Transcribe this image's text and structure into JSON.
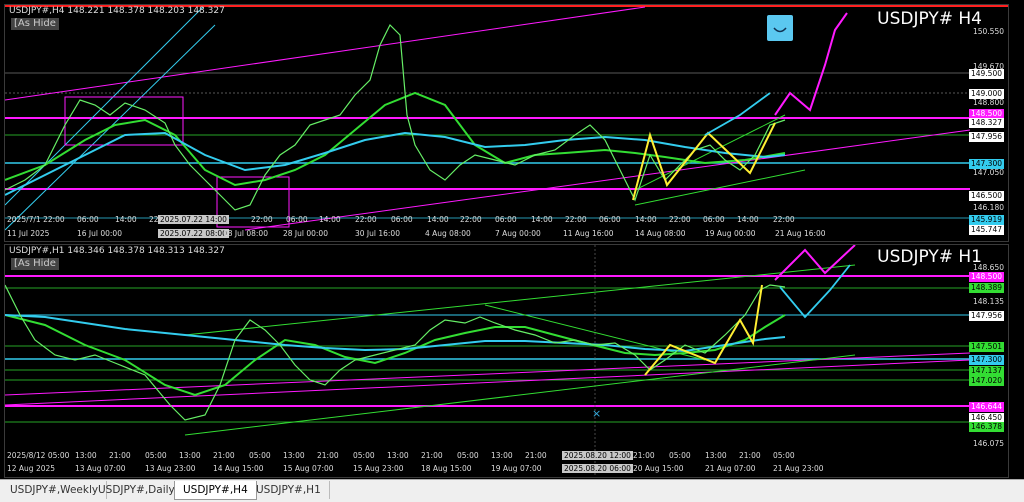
{
  "h4": {
    "header": "USDJPY#,H4  148.221 148.378 148.203 148.327",
    "hide_label": "[As Hide",
    "big_title": "USDJPY# H4",
    "price_boxes": [
      {
        "text": "149.500"
      },
      {
        "text": "149.000"
      },
      {
        "text": "148.500"
      },
      {
        "text": "148.327"
      },
      {
        "text": "147.956"
      },
      {
        "text": "147.300"
      },
      {
        "text": "146.500"
      },
      {
        "text": "145.919"
      },
      {
        "text": "145.747"
      }
    ],
    "price_texts": [
      "150.550",
      "149.670",
      "148.800",
      "147.050",
      "146.180"
    ],
    "time_labels": [
      "11 Jul 2025",
      "16 Jul 00:00",
      "18 Jul 08:00",
      "28 Jul 00:00",
      "30 Jul 16:00",
      "4 Aug 08:00",
      "7 Aug 00:00",
      "11 Aug 16:00",
      "14 Aug 08:00",
      "19 Aug 00:00",
      "21 Aug 16:00"
    ],
    "time_box": "2025.07.22 08:00",
    "inner_times": [
      "2025/7/1 22:00",
      "06:00",
      "14:00",
      "22",
      "2025.07.22 14:00",
      "14:00",
      "22:00",
      "06:00",
      "14:00",
      "22:00",
      "06:00",
      "14:00",
      "22:00",
      "06:00",
      "14:00",
      "22:00",
      "06:00",
      "14:00",
      "22:00",
      "06:00",
      "14:00",
      "22:00"
    ]
  },
  "h1": {
    "header": "USDJPY#,H1  148.346 148.378 148.313 148.327",
    "hide_label": "[As Hide",
    "big_title": "USDJPY# H1",
    "price_boxes": [
      {
        "text": "148.500"
      },
      {
        "text": "148.389"
      },
      {
        "text": "147.956"
      },
      {
        "text": "147.501"
      },
      {
        "text": "147.300"
      },
      {
        "text": "147.137"
      },
      {
        "text": "147.020"
      },
      {
        "text": "146.644"
      },
      {
        "text": "146.450"
      },
      {
        "text": "146.378"
      }
    ],
    "price_texts": [
      "148.650",
      "148.135",
      "146.075"
    ],
    "time_labels": [
      "12 Aug 2025",
      "13 Aug 07:00",
      "13 Aug 23:00",
      "14 Aug 15:00",
      "15 Aug 07:00",
      "15 Aug 23:00",
      "18 Aug 15:00",
      "19 Aug 07:00",
      "20 Aug 15:00",
      "21 Aug 07:00",
      "21 Aug 23:00"
    ],
    "time_box": "2025.08.20 06:00",
    "inner_times": [
      "2025/8/12 05:00",
      "13:00",
      "21:00",
      "05:00",
      "13:00",
      "21:00",
      "05:00",
      "13:00",
      "21:00",
      "05:00",
      "13:00",
      "21:00",
      "05:00",
      "13:00",
      "21:00",
      "2025.08.20 12:00",
      "21:00",
      "05:00",
      "13:00",
      "21:00",
      "05:00"
    ]
  },
  "tabs": [
    {
      "label": "USDJPY#,Weekly",
      "active": false
    },
    {
      "label": "USDJPY#,Daily",
      "active": false
    },
    {
      "label": "USDJPY#,H4",
      "active": true
    },
    {
      "label": "USDJPY#,H1",
      "active": false
    }
  ],
  "colors": {
    "background": "#000000",
    "magenta": "#ff1aff",
    "cyan": "#33ccee",
    "green": "#33dd33",
    "yellow": "#ffee33",
    "candle": "#66ee66"
  }
}
